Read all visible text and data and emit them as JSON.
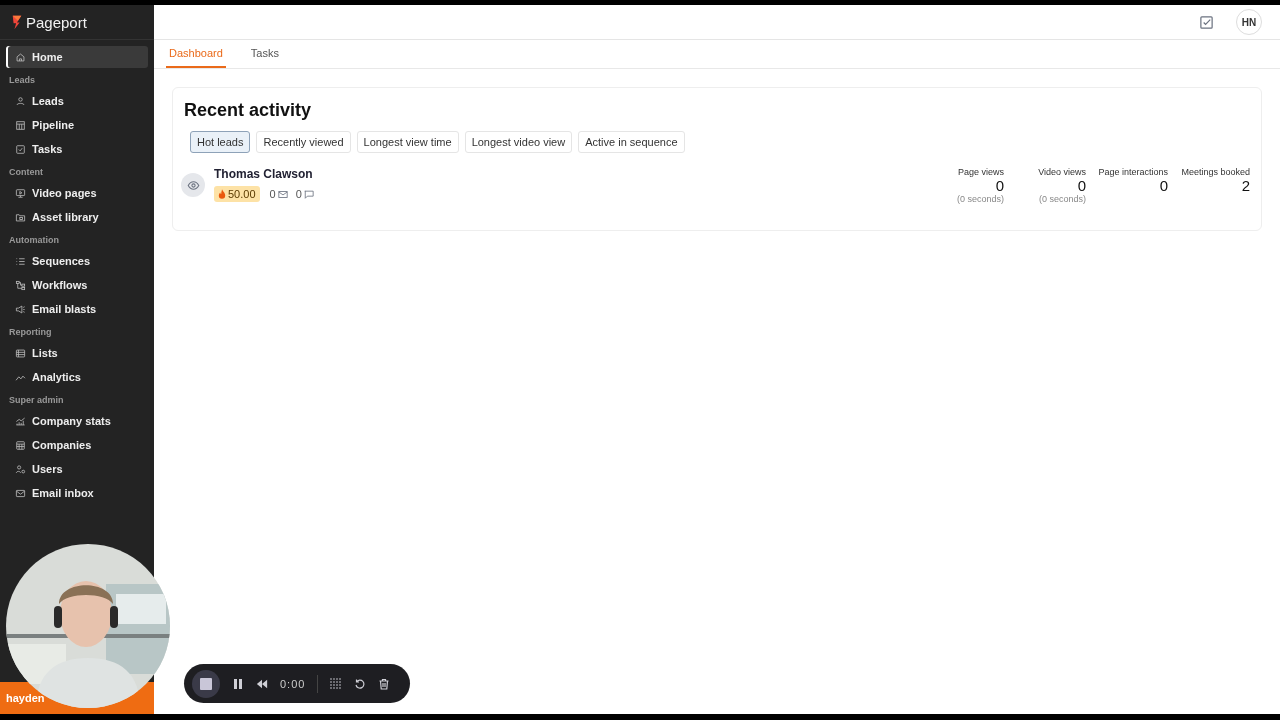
{
  "app": {
    "logo": "Pageport"
  },
  "sidebar": {
    "home": {
      "label": "Home",
      "selected": true
    },
    "sections": [
      {
        "heading": "Leads",
        "items": [
          {
            "label": "Leads",
            "selected": false
          },
          {
            "label": "Pipeline",
            "selected": false
          },
          {
            "label": "Tasks",
            "selected": false
          }
        ]
      },
      {
        "heading": "Content",
        "items": [
          {
            "label": "Video pages",
            "selected": false
          },
          {
            "label": "Asset library",
            "selected": false
          }
        ]
      },
      {
        "heading": "Automation",
        "items": [
          {
            "label": "Sequences",
            "selected": false
          },
          {
            "label": "Workflows",
            "selected": false
          },
          {
            "label": "Email blasts",
            "selected": false
          }
        ]
      },
      {
        "heading": "Reporting",
        "items": [
          {
            "label": "Lists",
            "selected": false
          },
          {
            "label": "Analytics",
            "selected": false
          }
        ]
      },
      {
        "heading": "Super admin",
        "items": [
          {
            "label": "Company stats",
            "selected": false
          },
          {
            "label": "Companies",
            "selected": false
          },
          {
            "label": "Users",
            "selected": false
          },
          {
            "label": "Email inbox",
            "selected": false
          }
        ]
      }
    ],
    "user_bar": {
      "label": "hayden"
    }
  },
  "header": {
    "avatar": "HN"
  },
  "tabs": [
    {
      "label": "Dashboard",
      "selected": true
    },
    {
      "label": "Tasks",
      "selected": false
    }
  ],
  "card": {
    "title": "Recent activity",
    "filters": [
      {
        "label": "Hot leads",
        "selected": true
      },
      {
        "label": "Recently viewed",
        "selected": false
      },
      {
        "label": "Longest view time",
        "selected": false
      },
      {
        "label": "Longest video view",
        "selected": false
      },
      {
        "label": "Active in sequence",
        "selected": false
      }
    ],
    "leads": [
      {
        "name": "Thomas Clawson",
        "score": "50.00",
        "emails": "0",
        "messages": "0",
        "stats": [
          {
            "label": "Page views",
            "value": "0",
            "note": "(0 seconds)"
          },
          {
            "label": "Video views",
            "value": "0",
            "note": "(0 seconds)"
          },
          {
            "label": "Page interactions",
            "value": "0"
          },
          {
            "label": "Meetings booked",
            "value": "2"
          }
        ]
      }
    ]
  },
  "recorder": {
    "time": "0:00"
  }
}
